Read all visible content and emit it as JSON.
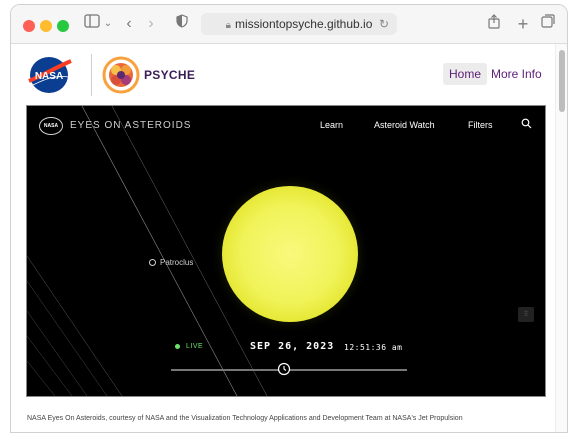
{
  "browser": {
    "url": "missiontopsyche.github.io",
    "icons": [
      "sidebar-icon",
      "chevron-down-icon",
      "back-icon",
      "forward-icon",
      "shield-icon",
      "lock-icon",
      "reload-icon",
      "share-icon",
      "new-tab-icon",
      "tabs-icon"
    ]
  },
  "header": {
    "nasa_logo_text": "NASA",
    "psyche_word": "PSYCHE",
    "nav": {
      "home": "Home",
      "more_info": "More Info"
    }
  },
  "embed": {
    "title": "EYES ON ASTEROIDS",
    "nav": [
      "Learn",
      "Asteroid Watch",
      "Filters"
    ],
    "object_label": "Patroclus",
    "live_label": "LIVE",
    "date": "SEP 26, 2023",
    "time": "12:51:36 am",
    "colors": {
      "live": "#6be26a",
      "sun": "#f1f35a"
    }
  },
  "caption": "NASA Eyes On Asteroids, courtesy of NASA and the Visualization Technology Applications and Development Team at NASA's Jet Propulsion"
}
